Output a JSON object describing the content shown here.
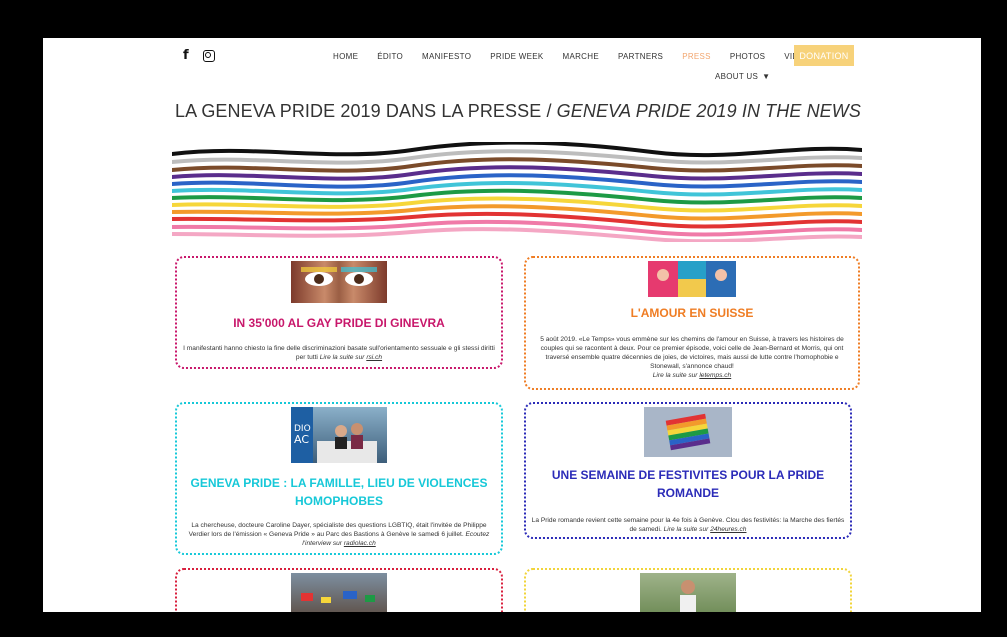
{
  "header": {
    "social": [
      "facebook-icon",
      "instagram-icon"
    ],
    "nav": [
      {
        "label": "HOME",
        "active": false
      },
      {
        "label": "ÉDITO",
        "active": false
      },
      {
        "label": "MANIFESTO",
        "active": false
      },
      {
        "label": "PRIDE WEEK",
        "active": false
      },
      {
        "label": "MARCHE",
        "active": false
      },
      {
        "label": "PARTNERS",
        "active": false
      },
      {
        "label": "PRESS",
        "active": true
      },
      {
        "label": "PHOTOS",
        "active": false
      },
      {
        "label": "VIDÉOS",
        "active": false
      }
    ],
    "donate_label": "DONATION",
    "about_label": "ABOUT US",
    "colors": {
      "accent": "#f2a66f",
      "donate": "#f7d27a"
    }
  },
  "page": {
    "title_fr": "LA GENEVA PRIDE 2019 DANS LA PRESSE / ",
    "title_en": "GENEVA PRIDE 2019 IN THE NEWS"
  },
  "cards": [
    {
      "title": "IN 35'000 AL GAY PRIDE DI GINEVRA",
      "color": "#c8176b",
      "text": "I manifestanti hanno chiesto la fine delle discriminazioni basate sull'orientamento sessuale e gli stessi diritti per tutti",
      "more": "Lire la suite sur",
      "link": "rsi.ch"
    },
    {
      "title": "L'AMOUR EN SUISSE",
      "color": "#ef7d24",
      "text": "5 août 2019. «Le Temps» vous emmène sur les chemins de l'amour en Suisse, à travers les histoires de couples qui se racontent à deux. Pour ce premier épisode, voici celle de Jean-Bernard et Morris, qui ont traversé ensemble quatre décennies de joies, de victoires, mais aussi de lutte contre l'homophobie e Stonewall, s'annonce chaud!",
      "more": "Lire la suite sur",
      "link": "letemps.ch"
    },
    {
      "title": "GENEVA PRIDE : LA FAMILLE, LIEU DE VIOLENCES HOMOPHOBES",
      "color": "#16c8d8",
      "text": "La chercheuse, docteure Caroline Dayer, spécialiste des questions LGBTIQ, était l'invitée de Philippe Verdier lors de l'émission « Geneva Pride » au Parc des Bastions à Genève le samedi 6 juillet.",
      "more": "Ecoutez l'interview sur",
      "link": "radiolac.ch"
    },
    {
      "title": "UNE SEMAINE DE FESTIVITES POUR LA PRIDE ROMANDE",
      "color": "#2b2bb8",
      "text": "La Pride romande revient cette semaine pour la 4e fois à Genève. Clou des festivités: la Marche des fiertés de samedi.",
      "more": "Lire la suite sur",
      "link": "24heures.ch"
    },
    {
      "title": "",
      "color": "#d81f3d",
      "text": "",
      "more": "",
      "link": ""
    },
    {
      "title": "",
      "color": "#f1d43a",
      "text": "",
      "more": "",
      "link": ""
    }
  ]
}
